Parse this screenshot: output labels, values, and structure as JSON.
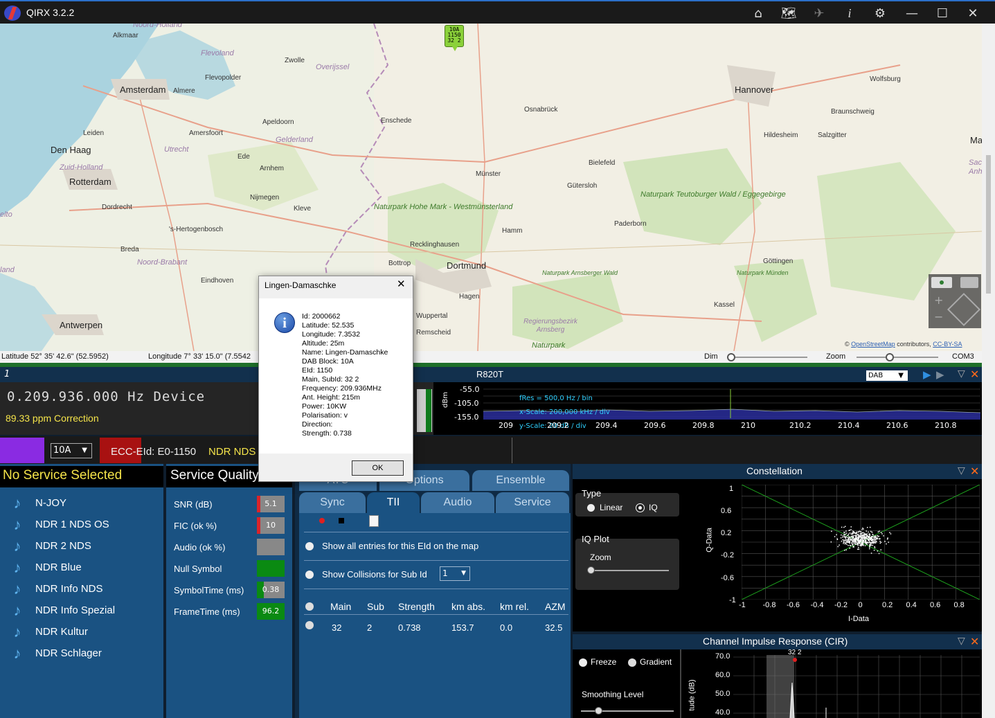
{
  "app": {
    "title": "QIRX 3.2.2"
  },
  "map": {
    "cities": [
      "Alkmaar",
      "Amsterdam",
      "Almere",
      "Flevopolder",
      "Flevoland",
      "Zwolle",
      "Overijssel",
      "Leiden",
      "Den Haag",
      "Zuid-Holland",
      "Rotterdam",
      "Amersfoort",
      "Utrecht",
      "Apeldoorn",
      "Gelderland",
      "Ede",
      "Arnhem",
      "Nijmegen",
      "Kleve",
      "Dordrecht",
      "'s-Hertogenbosch",
      "Breda",
      "Noord-Brabant",
      "Eindhoven",
      "Antwerpen",
      "Enschede",
      "Osnabrück",
      "Münster",
      "Bielefeld",
      "Gütersloh",
      "Paderborn",
      "Hamm",
      "Recklinghausen",
      "Bottrop",
      "Dortmund",
      "Hagen",
      "Wuppertal",
      "Remscheid",
      "Hannover",
      "Wolfsburg",
      "Braunschweig",
      "Hildesheim",
      "Salzgitter",
      "Göttingen",
      "Kassel",
      "Regierungsbezirk Arnsberg",
      "Noord-Holland",
      "elto",
      "land",
      "Ma",
      "Sac",
      "Anh"
    ],
    "parks": [
      "Naturpark Hohe Mark - Westmünsterland",
      "Naturpark Teutoburger Wald / Eggegebirge",
      "Naturpark Arnsberger Wald",
      "Naturpark Münden",
      "Naturpark"
    ],
    "marker": [
      "10A",
      "1150",
      "32 2"
    ],
    "attribution": {
      "copy": "©",
      "osm": "OpenStreetMap",
      "contributors": "contributors,",
      "license": "CC-BY-SA"
    }
  },
  "status": {
    "latitude": "Latitude  52° 35' 42.6\" (52.5952)",
    "longitude": "Longitude  7° 33' 15.0\" (7.5542",
    "dim": "Dim",
    "zoom": "Zoom",
    "port": "COM3"
  },
  "device": {
    "index": "1",
    "name": "R820T",
    "mode": "DAB",
    "frequency": "0.209.936.000 Hz Device",
    "correction": "89.33 ppm Correction",
    "spectrum": {
      "ylabel": "dBm",
      "yticks": [
        "-55.0",
        "-105.0",
        "-155.0"
      ],
      "xticks": [
        "209",
        "209.2",
        "209.4",
        "209.6",
        "209.8",
        "210",
        "210.2",
        "210.4",
        "210.6",
        "210.8"
      ],
      "fres": "fRes = 500,0 Hz / bin",
      "xscale": "x-Scale: 200,000 kHz / div",
      "yscale": "y-Scale: 20 dB / div"
    }
  },
  "selector": {
    "block": "10A",
    "ecc": "ECC-EId: E0-1150",
    "ensemble": "NDR NDS"
  },
  "services": {
    "title": "No Service Selected",
    "items": [
      "N-JOY",
      "NDR 1 NDS OS",
      "NDR 2 NDS",
      "NDR Blue",
      "NDR Info NDS",
      "NDR Info Spezial",
      "NDR Kultur",
      "NDR Schlager"
    ]
  },
  "quality": {
    "title": "Service Quality",
    "rows": [
      {
        "label": "SNR (dB)",
        "value": "5.1",
        "color": "#d9242a"
      },
      {
        "label": "FIC (ok %)",
        "value": "10",
        "color": "#d9242a"
      },
      {
        "label": "Audio (ok %)",
        "value": "",
        "color": "#888888"
      },
      {
        "label": "Null Symbol",
        "value": "",
        "color": "#0a8a12"
      },
      {
        "label": "SymbolTime (ms)",
        "value": "0.38",
        "color": "#0a8a12"
      },
      {
        "label": "FrameTime (ms)",
        "value": "96.2",
        "color": "#0a8a12"
      }
    ]
  },
  "tabs": {
    "row1": [
      "ATC",
      "Options",
      "Ensemble"
    ],
    "row2": [
      "Sync",
      "TII",
      "Audio",
      "Service"
    ]
  },
  "tii": {
    "show_all": "Show all entries for this EId on the map",
    "show_collisions": "Show Collisions for Sub Id",
    "subid": "1",
    "headers": [
      "Main",
      "Sub",
      "Strength",
      "km abs.",
      "km rel.",
      "AZM"
    ],
    "rows": [
      [
        "32",
        "2",
        "0.738",
        "153.7",
        "0.0",
        "32.5"
      ]
    ]
  },
  "constellation": {
    "title": "Constellation",
    "type_label": "Type",
    "linear": "Linear",
    "iq": "IQ",
    "iqplot": "IQ Plot",
    "zoom": "Zoom",
    "ylabel": "Q-Data",
    "xlabel": "I-Data",
    "yticks": [
      "1",
      "0.6",
      "0.2",
      "-0.2",
      "-0.6",
      "-1"
    ],
    "xticks": [
      "-1",
      "-0.8",
      "-0.6",
      "-0.4",
      "-0.2",
      "0",
      "0.2",
      "0.4",
      "0.6",
      "0.8"
    ]
  },
  "cir": {
    "title": "Channel Impulse Response (CIR)",
    "freeze": "Freeze",
    "gradient": "Gradient",
    "smoothing": "Smoothing Level",
    "ylabel": "tude (dB)",
    "yticks": [
      "70.0",
      "60.0",
      "50.0",
      "40.0"
    ],
    "peak": "32 2"
  },
  "dialog": {
    "title": "Lingen-Damaschke",
    "lines": [
      "Id: 2000662",
      "Latitude: 52.535",
      "Longitude: 7.3532",
      "Altitude: 25m",
      "Name: Lingen-Damaschke",
      "DAB Block: 10A",
      "EId: 1150",
      "Main, SubId: 32 2",
      "Frequency: 209.936MHz",
      "Ant. Height: 215m",
      "Power: 10KW",
      "Polarisation: v",
      "Direction:",
      "Strength: 0.738"
    ],
    "ok": "OK"
  }
}
